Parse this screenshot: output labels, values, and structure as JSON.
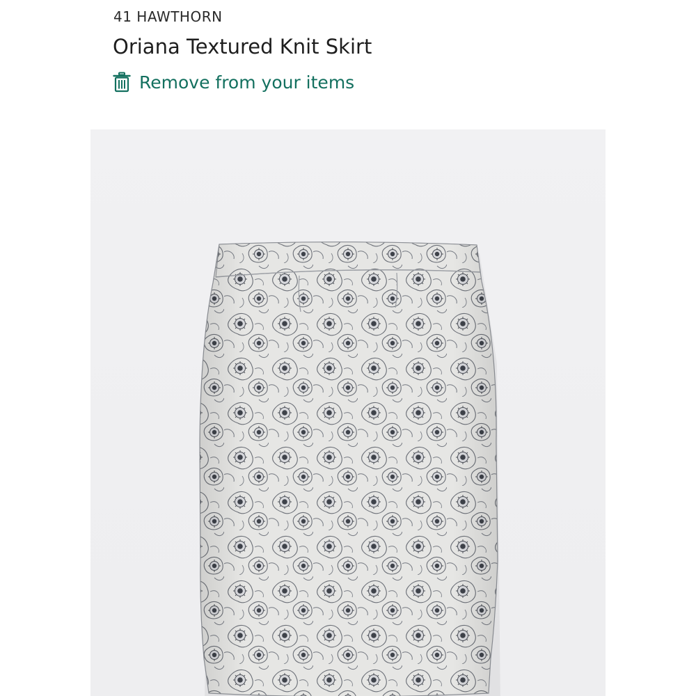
{
  "product": {
    "brand": "41 HAWTHORN",
    "name": "Oriana Textured Knit Skirt",
    "remove_label": "Remove from your items"
  },
  "icons": {
    "remove": "trash-icon"
  },
  "colors": {
    "accent": "#13705f",
    "text": "#1e1e1e",
    "photo_background": "#f0f0f2",
    "fabric": "#e4e4e2",
    "print": "#4a4e56"
  }
}
